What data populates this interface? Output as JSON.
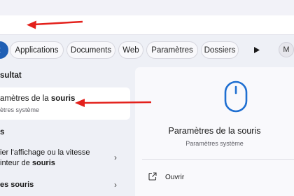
{
  "search": {
    "query": ""
  },
  "filters": {
    "all_label": "t",
    "items": [
      "Applications",
      "Documents",
      "Web",
      "Paramètres",
      "Dossiers"
    ],
    "more_icon": "play-icon",
    "avatar_initial": "M"
  },
  "results": {
    "best_match_heading": "sultat",
    "best_match": {
      "title_prefix": "amètres de la ",
      "title_bold": "souris",
      "subtitle": "ètres système"
    },
    "section_heading": "s",
    "items": [
      {
        "line1": "ier l'affichage ou la vitesse",
        "line2_prefix": "inteur de ",
        "line2_bold": "souris"
      },
      {
        "line1_bold": "es souris"
      }
    ]
  },
  "detail": {
    "icon": "mouse-icon",
    "title": "Paramètres de la souris",
    "subtitle": "Paramètres système",
    "actions": [
      {
        "icon": "open-external-icon",
        "label": "Ouvrir"
      }
    ]
  },
  "colors": {
    "accent": "#1f5fb4",
    "annotation_arrow": "#e3201b"
  }
}
